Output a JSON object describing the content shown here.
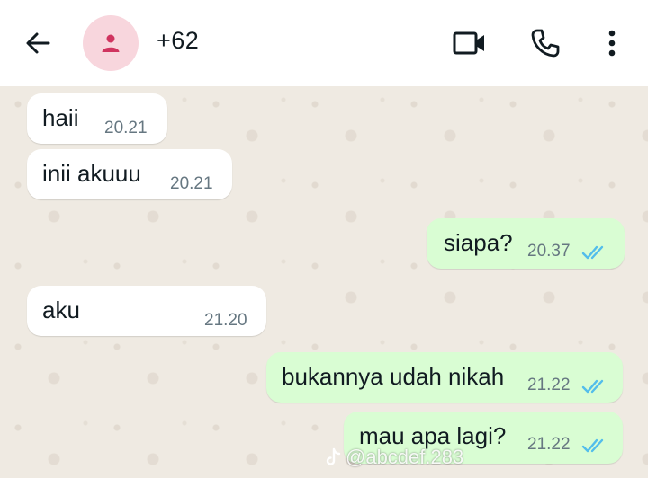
{
  "header": {
    "contact_name": "+62",
    "back_icon": "arrow-left-icon",
    "avatar_icon": "person-icon",
    "video_icon": "video-camera-icon",
    "call_icon": "phone-icon",
    "more_icon": "more-vertical-icon"
  },
  "colors": {
    "header_bg": "#ffffff",
    "chat_bg": "#efeae2",
    "incoming_bubble": "#ffffff",
    "outgoing_bubble": "#d9fdd3",
    "read_ticks": "#53bdeb",
    "avatar_bg": "#f8d6dd",
    "avatar_fg": "#d0345f"
  },
  "messages": [
    {
      "direction": "incoming",
      "text": "haii",
      "time": "20.21"
    },
    {
      "direction": "incoming",
      "text": "inii akuuu",
      "time": "20.21"
    },
    {
      "direction": "outgoing",
      "text": "siapa?",
      "time": "20.37",
      "status": "read"
    },
    {
      "direction": "incoming",
      "text": "aku",
      "time": "21.20"
    },
    {
      "direction": "outgoing",
      "text": "bukannya udah nikah",
      "time": "21.22",
      "status": "read"
    },
    {
      "direction": "outgoing",
      "text": "mau apa lagi?",
      "time": "21.22",
      "status": "read"
    }
  ],
  "watermark": {
    "logo": "tiktok-logo-icon",
    "handle": "@abcdef.283"
  }
}
